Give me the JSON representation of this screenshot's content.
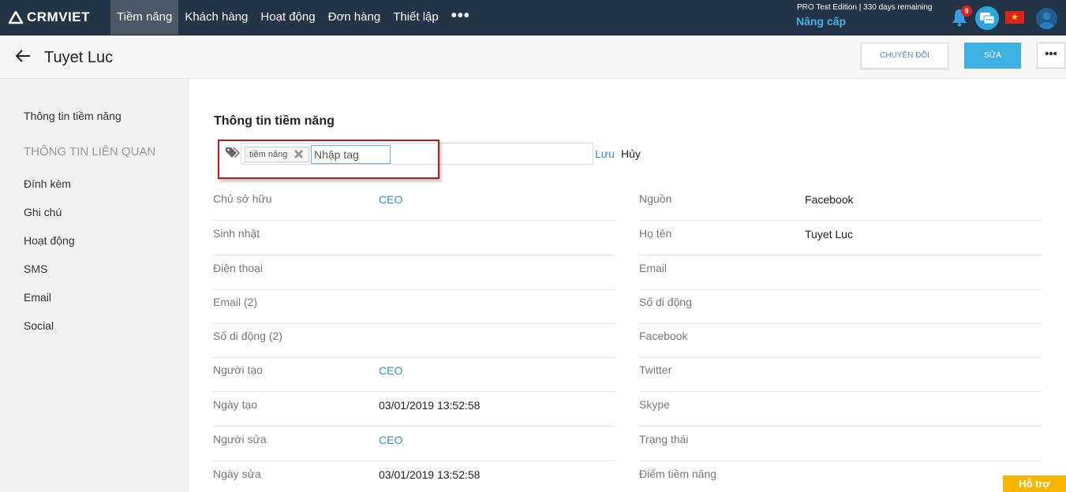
{
  "brand": {
    "logo_text": "CRMVIET"
  },
  "nav": {
    "items": [
      {
        "label": "Tiềm năng",
        "active": true
      },
      {
        "label": "Khách hàng",
        "active": false
      },
      {
        "label": "Hoạt động",
        "active": false
      },
      {
        "label": "Đơn hàng",
        "active": false
      },
      {
        "label": "Thiết lập",
        "active": false
      }
    ],
    "more_label": "•••"
  },
  "account": {
    "edition": "PRO Test Edition | 330 days remaining",
    "upgrade_label": "Nâng cấp",
    "notification_count": "9",
    "flag_star": "★"
  },
  "header": {
    "back_icon": "arrow-left-icon",
    "title": "Tuyet Luc",
    "convert_label": "CHUYỂN ĐỔI",
    "edit_label": "SỬA",
    "more_label": "•••"
  },
  "sidebar": {
    "main_item": "Thông tin tiềm năng",
    "related_heading": "THÔNG TIN LIÊN QUAN",
    "items": [
      "Đính kèm",
      "Ghi chú",
      "Hoạt động",
      "SMS",
      "Email",
      "Social"
    ]
  },
  "main": {
    "section_title": "Thông tin tiềm năng",
    "tags": {
      "chip_label": "tiềm năng",
      "input_placeholder": "Nhập tag",
      "save_label": "Lưu",
      "cancel_label": "Hủy"
    },
    "left_fields": [
      {
        "label": "Chủ sở hữu",
        "value": "CEO",
        "link": true
      },
      {
        "label": "Sinh nhật",
        "value": "",
        "link": false
      },
      {
        "label": "Điện thoại",
        "value": "",
        "link": false
      },
      {
        "label": "Email (2)",
        "value": "",
        "link": false
      },
      {
        "label": "Số di động (2)",
        "value": "",
        "link": false
      },
      {
        "label": "Người tạo",
        "value": "CEO",
        "link": true
      },
      {
        "label": "Ngày tạo",
        "value": "03/01/2019 13:52:58",
        "link": false
      },
      {
        "label": "Người sửa",
        "value": "CEO",
        "link": true
      },
      {
        "label": "Ngày sửa",
        "value": "03/01/2019 13:52:58",
        "link": false
      }
    ],
    "right_fields": [
      {
        "label": "Nguồn",
        "value": "Facebook"
      },
      {
        "label": "Họ tên",
        "value": "Tuyet Luc"
      },
      {
        "label": "Email",
        "value": ""
      },
      {
        "label": "Số di động",
        "value": ""
      },
      {
        "label": "Facebook",
        "value": ""
      },
      {
        "label": "Twitter",
        "value": ""
      },
      {
        "label": "Skype",
        "value": ""
      },
      {
        "label": "Trạng thái",
        "value": ""
      },
      {
        "label": "Điểm tiềm năng",
        "value": ""
      }
    ]
  },
  "support_label": "Hỗ trợ",
  "colors": {
    "topbar": "#243447",
    "accent": "#3db1e2",
    "link": "#2f8fd0",
    "highlight": "#b21c1c",
    "support": "#f7b500"
  }
}
